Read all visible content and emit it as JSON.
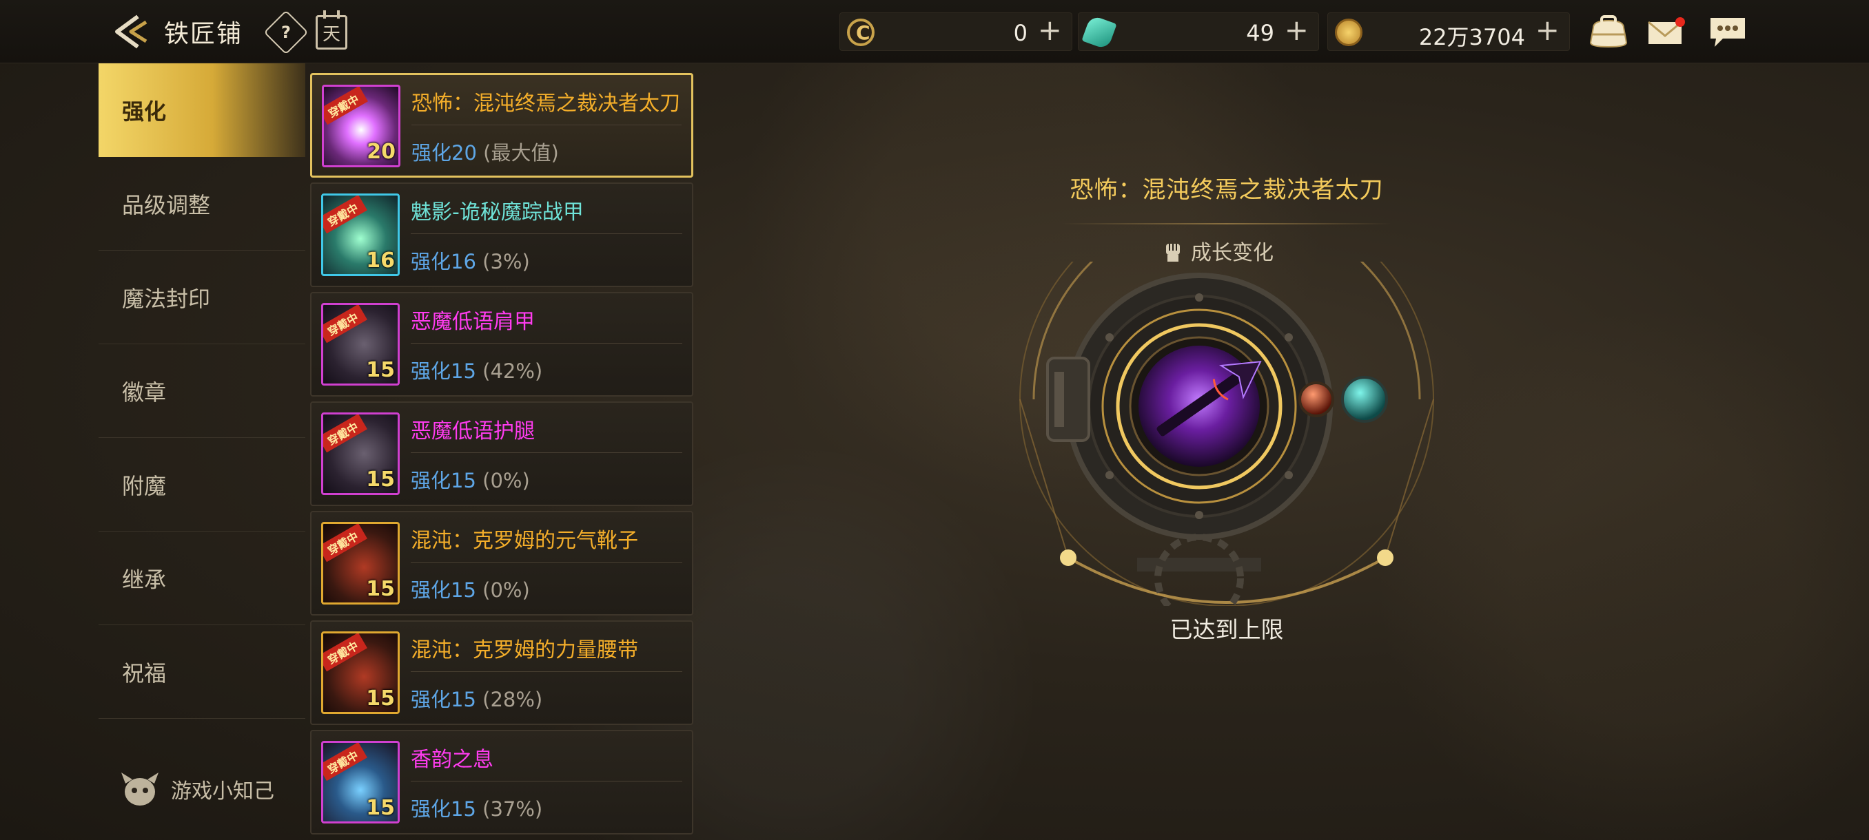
{
  "header": {
    "title": "铁匠铺",
    "help_icon": "?",
    "calendar_icon": "天"
  },
  "currencies": [
    {
      "name": "token-currency",
      "value": "0"
    },
    {
      "name": "gem-currency",
      "value": "49"
    },
    {
      "name": "gold-currency",
      "value": "22万3704"
    }
  ],
  "plus_symbol": "+",
  "nav": {
    "items": [
      "强化",
      "品级调整",
      "魔法封印",
      "徽章",
      "附魔",
      "继承",
      "祝福"
    ],
    "active_index": 0,
    "tips_label": "游戏小知己"
  },
  "equipment": [
    {
      "name": "恐怖：混沌终焉之裁决者太刀",
      "level_label": "强化20",
      "detail": "(最大值)",
      "level_num": "20",
      "rarity": "epic",
      "frame": "pink",
      "selected": true
    },
    {
      "name": "魅影-诡秘魔踪战甲",
      "level_label": "强化16",
      "detail": "(3%)",
      "level_num": "16",
      "rarity": "set",
      "frame": "blue",
      "selected": false
    },
    {
      "name": "恶魔低语肩甲",
      "level_label": "强化15",
      "detail": "(42%)",
      "level_num": "15",
      "rarity": "legend",
      "frame": "purple",
      "selected": false
    },
    {
      "name": "恶魔低语护腿",
      "level_label": "强化15",
      "detail": "(0%)",
      "level_num": "15",
      "rarity": "legend",
      "frame": "purple",
      "selected": false
    },
    {
      "name": "混沌：克罗姆的元气靴子",
      "level_label": "强化15",
      "detail": "(0%)",
      "level_num": "15",
      "rarity": "epic",
      "frame": "gold",
      "selected": false
    },
    {
      "name": "混沌：克罗姆的力量腰带",
      "level_label": "强化15",
      "detail": "(28%)",
      "level_num": "15",
      "rarity": "epic",
      "frame": "gold",
      "selected": false
    },
    {
      "name": "香韵之息",
      "level_label": "强化15",
      "detail": "(37%)",
      "level_num": "15",
      "rarity": "legend",
      "frame": "purple",
      "selected": false
    }
  ],
  "equipment_badge": "穿戴中",
  "detail": {
    "title": "恐怖：混沌终焉之裁决者太刀",
    "growth_label": "成长变化",
    "status": "已达到上限"
  },
  "colors": {
    "accent_gold": "#f4cb5c",
    "rarity_epic": "#f4ae2a",
    "rarity_legend": "#ff3cf0",
    "rarity_set": "#6fe3d8",
    "level_blue": "#5ea6e6"
  }
}
